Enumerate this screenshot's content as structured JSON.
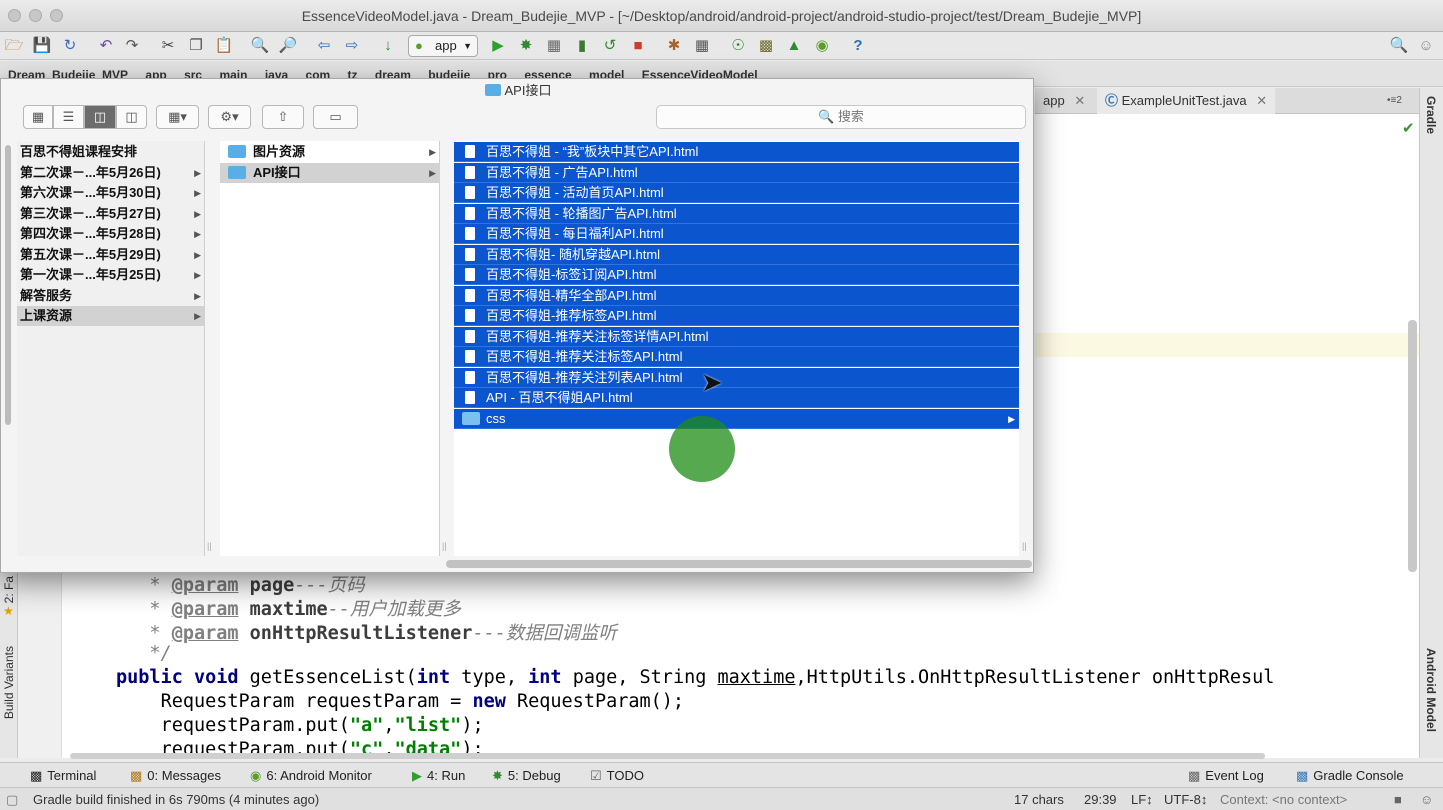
{
  "ide": {
    "title": "EssenceVideoModel.java - Dream_Budejie_MVP - [~/Desktop/android/android-project/android-studio-project/test/Dream_Budejie_MVP]",
    "run_config": "app",
    "breadcrumb": [
      "Dream_Budejie_MVP",
      "app",
      "src",
      "main",
      "java",
      "com",
      "tz",
      "dream",
      "budejie",
      "pro",
      "essence",
      "model",
      "EssenceVideoModel"
    ],
    "tabs": [
      {
        "label": "app"
      },
      {
        "label": "ExampleUnitTest.java"
      }
    ],
    "tab_overflow": "2",
    "right_panel_labels": [
      "Gradle",
      "Android Model"
    ],
    "left_panel_labels": [
      "2: Fa",
      "Build Variants"
    ],
    "code_lines": {
      "l1": {
        "tag": "@param",
        "name": "page",
        "rest": "---页码"
      },
      "l2": {
        "tag": "@param",
        "name": "maxtime",
        "rest": "--用户加载更多"
      },
      "l3": {
        "tag": "@param",
        "name": "onHttpResultListener",
        "rest": "---数据回调监听"
      },
      "l4": "*/",
      "l5": {
        "kw1": "public",
        "kw2": "void",
        "fn": "getEssenceList(",
        "kw3": "int",
        "t1": " type, ",
        "kw4": "int",
        "t2": " page, String ",
        "v1": "maxtime",
        "t3": ",HttpUtils.OnHttpResultListener onHttpResul"
      },
      "l6": {
        "t1": "RequestParam requestParam = ",
        "kw": "new",
        "t2": " RequestParam();"
      },
      "l7": {
        "t1": "requestParam.put(",
        "s1": "\"a\"",
        "t2": ",",
        "s2": "\"list\"",
        "t3": ");"
      },
      "l8": {
        "t1": "requestParam.put(",
        "s1": "\"c\"",
        "t2": ",",
        "s2": "\"data\"",
        "t3": ");"
      }
    },
    "tool_windows": [
      {
        "label": "Terminal"
      },
      {
        "label": "0: Messages"
      },
      {
        "label": "6: Android Monitor"
      },
      {
        "label": "4: Run"
      },
      {
        "label": "5: Debug"
      },
      {
        "label": "TODO"
      },
      {
        "label": "Event Log"
      },
      {
        "label": "Gradle Console"
      }
    ],
    "status": {
      "message": "Gradle build finished in 6s 790ms (4 minutes ago)",
      "chars": "17 chars",
      "position": "29:39",
      "line_sep": "LF↕",
      "encoding": "UTF-8↕",
      "context": "Context: <no context>"
    }
  },
  "finder": {
    "title": "API接口",
    "search_placeholder": "搜索",
    "sidebar": [
      {
        "label": "百思不得姐课程安排",
        "arrow": false
      },
      {
        "label": "第二次课－...年5月26日)",
        "arrow": true
      },
      {
        "label": "第六次课－...年5月30日)",
        "arrow": true
      },
      {
        "label": "第三次课－...年5月27日)",
        "arrow": true
      },
      {
        "label": "第四次课－...年5月28日)",
        "arrow": true
      },
      {
        "label": "第五次课－...年5月29日)",
        "arrow": true
      },
      {
        "label": "第一次课－...年5月25日)",
        "arrow": true
      },
      {
        "label": "解答服务",
        "arrow": true
      },
      {
        "label": "上课资源",
        "arrow": true,
        "selected": true
      }
    ],
    "folders": [
      {
        "label": "图片资源",
        "selected": false
      },
      {
        "label": "API接口",
        "selected": true
      }
    ],
    "files": [
      {
        "label": "百思不得姐 - “我”板块中其它API.html",
        "kind": "file"
      },
      {
        "label": "百思不得姐 - 广告API.html",
        "kind": "file"
      },
      {
        "label": "百思不得姐 - 活动首页API.html",
        "kind": "file"
      },
      {
        "label": "百思不得姐 - 轮播图广告API.html",
        "kind": "file"
      },
      {
        "label": "百思不得姐 - 每日福利API.html",
        "kind": "file"
      },
      {
        "label": "百思不得姐- 随机穿越API.html",
        "kind": "file"
      },
      {
        "label": "百思不得姐-标签订阅API.html",
        "kind": "file"
      },
      {
        "label": "百思不得姐-精华全部API.html",
        "kind": "file"
      },
      {
        "label": "百思不得姐-推荐标签API.html",
        "kind": "file"
      },
      {
        "label": "百思不得姐-推荐关注标签详情API.html",
        "kind": "file"
      },
      {
        "label": "百思不得姐-推荐关注标签API.html",
        "kind": "file"
      },
      {
        "label": "百思不得姐-推荐关注列表API.html",
        "kind": "file"
      },
      {
        "label": "API - 百思不得姐API.html",
        "kind": "file"
      },
      {
        "label": "css",
        "kind": "folder"
      }
    ]
  }
}
